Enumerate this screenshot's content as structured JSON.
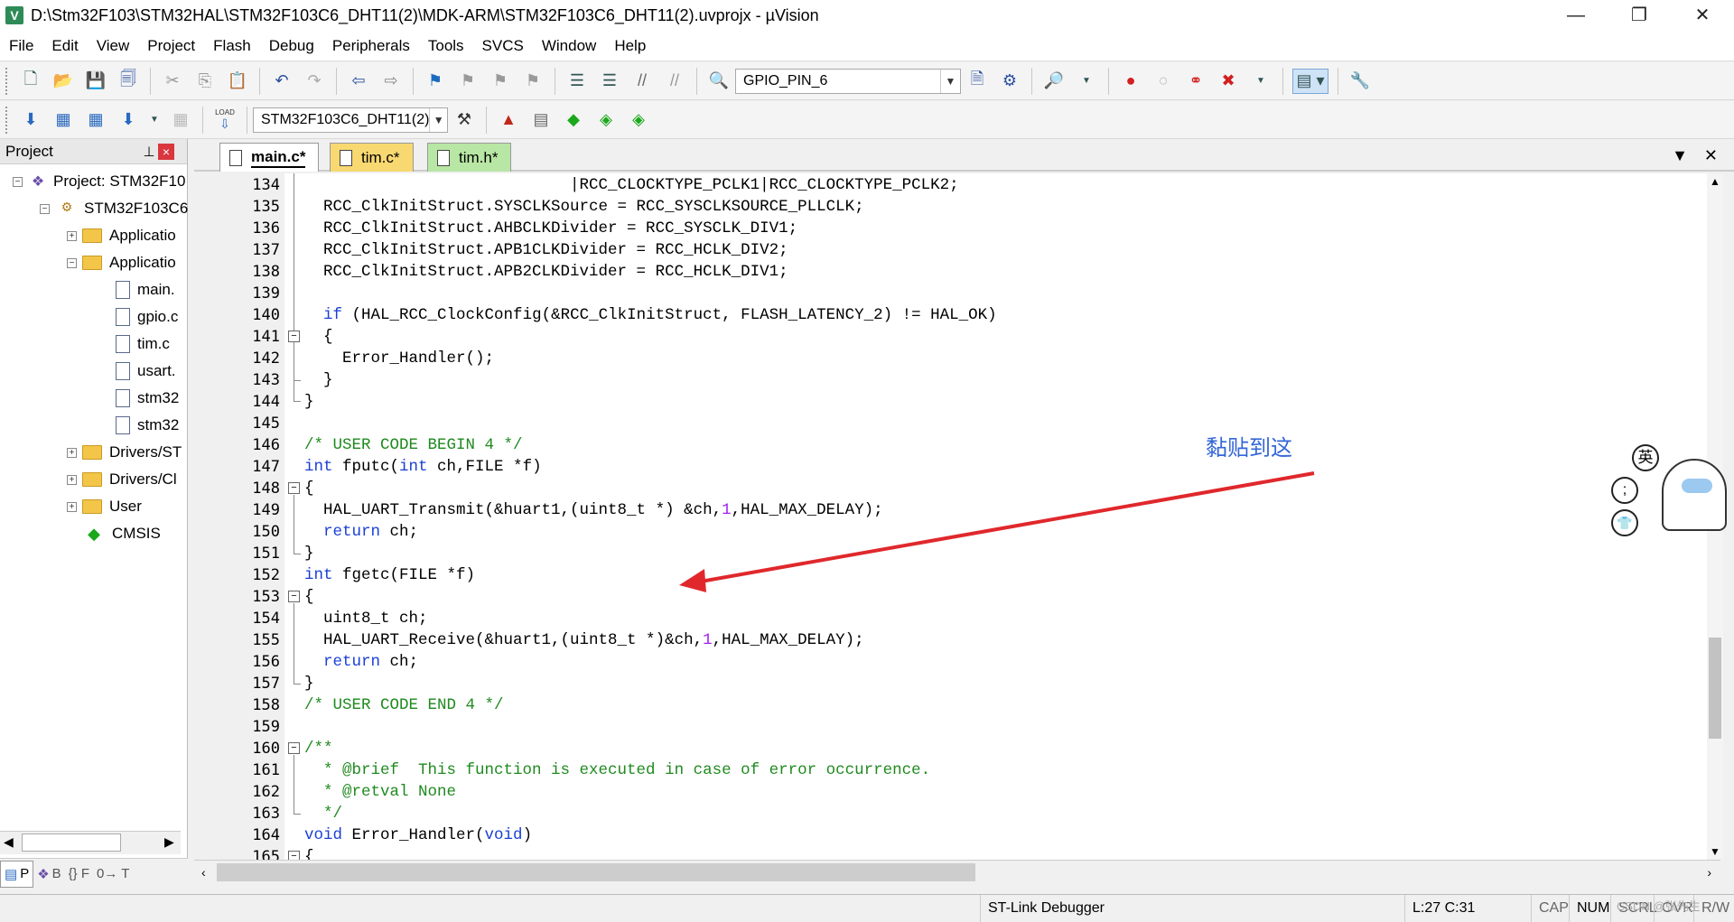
{
  "window": {
    "title": "D:\\Stm32F103\\STM32HAL\\STM32F103C6_DHT11(2)\\MDK-ARM\\STM32F103C6_DHT11(2).uvprojx - µVision",
    "app_icon": "V"
  },
  "menu": [
    "File",
    "Edit",
    "View",
    "Project",
    "Flash",
    "Debug",
    "Peripherals",
    "Tools",
    "SVCS",
    "Window",
    "Help"
  ],
  "toolbar1": {
    "find_combo_value": "GPIO_PIN_6"
  },
  "toolbar2": {
    "target_combo_value": "STM32F103C6_DHT11(2)",
    "load_label": "LOAD"
  },
  "project_panel": {
    "title": "Project",
    "tree": [
      {
        "label": "Project: STM32F10",
        "type": "project",
        "expander": "−"
      },
      {
        "label": "STM32F103C6",
        "type": "target",
        "expander": "−"
      },
      {
        "label": "Applicatio",
        "type": "folder",
        "expander": "+"
      },
      {
        "label": "Applicatio",
        "type": "folder",
        "expander": "−"
      },
      {
        "label": "main.",
        "type": "file"
      },
      {
        "label": "gpio.c",
        "type": "file"
      },
      {
        "label": "tim.c",
        "type": "file"
      },
      {
        "label": "usart.",
        "type": "file"
      },
      {
        "label": "stm32",
        "type": "file"
      },
      {
        "label": "stm32",
        "type": "file"
      },
      {
        "label": "Drivers/ST",
        "type": "folder",
        "expander": "+"
      },
      {
        "label": "Drivers/Cl",
        "type": "folder",
        "expander": "+"
      },
      {
        "label": "User",
        "type": "folder",
        "expander": "+"
      },
      {
        "label": "CMSIS",
        "type": "cmsis"
      }
    ],
    "bottom_tabs": [
      "P",
      "B",
      "{} F",
      "0→ T"
    ]
  },
  "editor": {
    "tabs": [
      {
        "label": "main.c*",
        "state": "active"
      },
      {
        "label": "tim.c*",
        "state": "modified"
      },
      {
        "label": "tim.h*",
        "state": "green"
      }
    ],
    "lines": [
      {
        "n": "134",
        "indent": 0,
        "parts": [
          [
            "",
            "                            |RCC_CLOCKTYPE_PCLK1|RCC_CLOCKTYPE_PCLK2;"
          ]
        ]
      },
      {
        "n": "135",
        "parts": [
          [
            "",
            "  RCC_ClkInitStruct.SYSCLKSource = RCC_SYSCLKSOURCE_PLLCLK;"
          ]
        ]
      },
      {
        "n": "136",
        "parts": [
          [
            "",
            "  RCC_ClkInitStruct.AHBCLKDivider = RCC_SYSCLK_DIV1;"
          ]
        ]
      },
      {
        "n": "137",
        "parts": [
          [
            "",
            "  RCC_ClkInitStruct.APB1CLKDivider = RCC_HCLK_DIV2;"
          ]
        ]
      },
      {
        "n": "138",
        "parts": [
          [
            "",
            "  RCC_ClkInitStruct.APB2CLKDivider = RCC_HCLK_DIV1;"
          ]
        ]
      },
      {
        "n": "139",
        "parts": [
          [
            "",
            ""
          ]
        ]
      },
      {
        "n": "140",
        "parts": [
          [
            "",
            "  "
          ],
          [
            "kw",
            "if"
          ],
          [
            "",
            " (HAL_RCC_ClockConfig(&RCC_ClkInitStruct, FLASH_LATENCY_2) != HAL_OK)"
          ]
        ]
      },
      {
        "n": "141",
        "parts": [
          [
            "",
            "  {"
          ]
        ]
      },
      {
        "n": "142",
        "parts": [
          [
            "",
            "    Error_Handler();"
          ]
        ]
      },
      {
        "n": "143",
        "parts": [
          [
            "",
            "  }"
          ]
        ]
      },
      {
        "n": "144",
        "parts": [
          [
            "",
            "}"
          ]
        ]
      },
      {
        "n": "145",
        "parts": [
          [
            "",
            ""
          ]
        ]
      },
      {
        "n": "146",
        "parts": [
          [
            "cmt",
            "/* USER CODE BEGIN 4 */"
          ]
        ]
      },
      {
        "n": "147",
        "parts": [
          [
            "kw",
            "int"
          ],
          [
            "",
            " fputc("
          ],
          [
            "kw",
            "int"
          ],
          [
            "",
            " ch,FILE *f)"
          ]
        ]
      },
      {
        "n": "148",
        "parts": [
          [
            "",
            "{"
          ]
        ]
      },
      {
        "n": "149",
        "parts": [
          [
            "",
            "  HAL_UART_Transmit(&huart1,(uint8_t *) &ch,"
          ],
          [
            "num",
            "1"
          ],
          [
            "",
            ",HAL_MAX_DELAY);"
          ]
        ]
      },
      {
        "n": "150",
        "parts": [
          [
            "",
            "  "
          ],
          [
            "kw",
            "return"
          ],
          [
            "",
            " ch;"
          ]
        ]
      },
      {
        "n": "151",
        "parts": [
          [
            "",
            "}"
          ]
        ]
      },
      {
        "n": "152",
        "parts": [
          [
            "kw",
            "int"
          ],
          [
            "",
            " fgetc(FILE *f)"
          ]
        ]
      },
      {
        "n": "153",
        "parts": [
          [
            "",
            "{"
          ]
        ]
      },
      {
        "n": "154",
        "parts": [
          [
            "",
            "  uint8_t ch;"
          ]
        ]
      },
      {
        "n": "155",
        "parts": [
          [
            "",
            "  HAL_UART_Receive(&huart1,(uint8_t *)&ch,"
          ],
          [
            "num",
            "1"
          ],
          [
            "",
            ",HAL_MAX_DELAY);"
          ]
        ]
      },
      {
        "n": "156",
        "parts": [
          [
            "",
            "  "
          ],
          [
            "kw",
            "return"
          ],
          [
            "",
            " ch;"
          ]
        ]
      },
      {
        "n": "157",
        "parts": [
          [
            "",
            "}"
          ]
        ]
      },
      {
        "n": "158",
        "parts": [
          [
            "cmt",
            "/* USER CODE END 4 */"
          ]
        ]
      },
      {
        "n": "159",
        "parts": [
          [
            "",
            ""
          ]
        ]
      },
      {
        "n": "160",
        "parts": [
          [
            "cmt",
            "/**"
          ]
        ]
      },
      {
        "n": "161",
        "parts": [
          [
            "cmt",
            "  * @brief  This function is executed in case of error occurrence."
          ]
        ]
      },
      {
        "n": "162",
        "parts": [
          [
            "cmt",
            "  * @retval None"
          ]
        ]
      },
      {
        "n": "163",
        "parts": [
          [
            "cmt",
            "  */"
          ]
        ]
      },
      {
        "n": "164",
        "parts": [
          [
            "kw",
            "void"
          ],
          [
            "",
            " Error_Handler("
          ],
          [
            "kw",
            "void"
          ],
          [
            "",
            ")"
          ]
        ]
      },
      {
        "n": "165",
        "parts": [
          [
            "",
            "{"
          ]
        ]
      }
    ]
  },
  "annotation": {
    "text": "黏贴到这"
  },
  "statusbar": {
    "debugger": "ST-Link Debugger",
    "position": "L:27 C:31",
    "caps": "CAP",
    "num": "NUM",
    "scrl": "SCRL",
    "ovr": "OVR",
    "rw": "R/W",
    "watermark": "CSDN @张先生"
  },
  "deco": {
    "glyph1": "英"
  },
  "colors": {
    "keyword": "#1a3fd6",
    "comment": "#1f8a1f",
    "number": "#a020f0",
    "arrow": "#e0282c",
    "annotation": "#3466d8"
  }
}
